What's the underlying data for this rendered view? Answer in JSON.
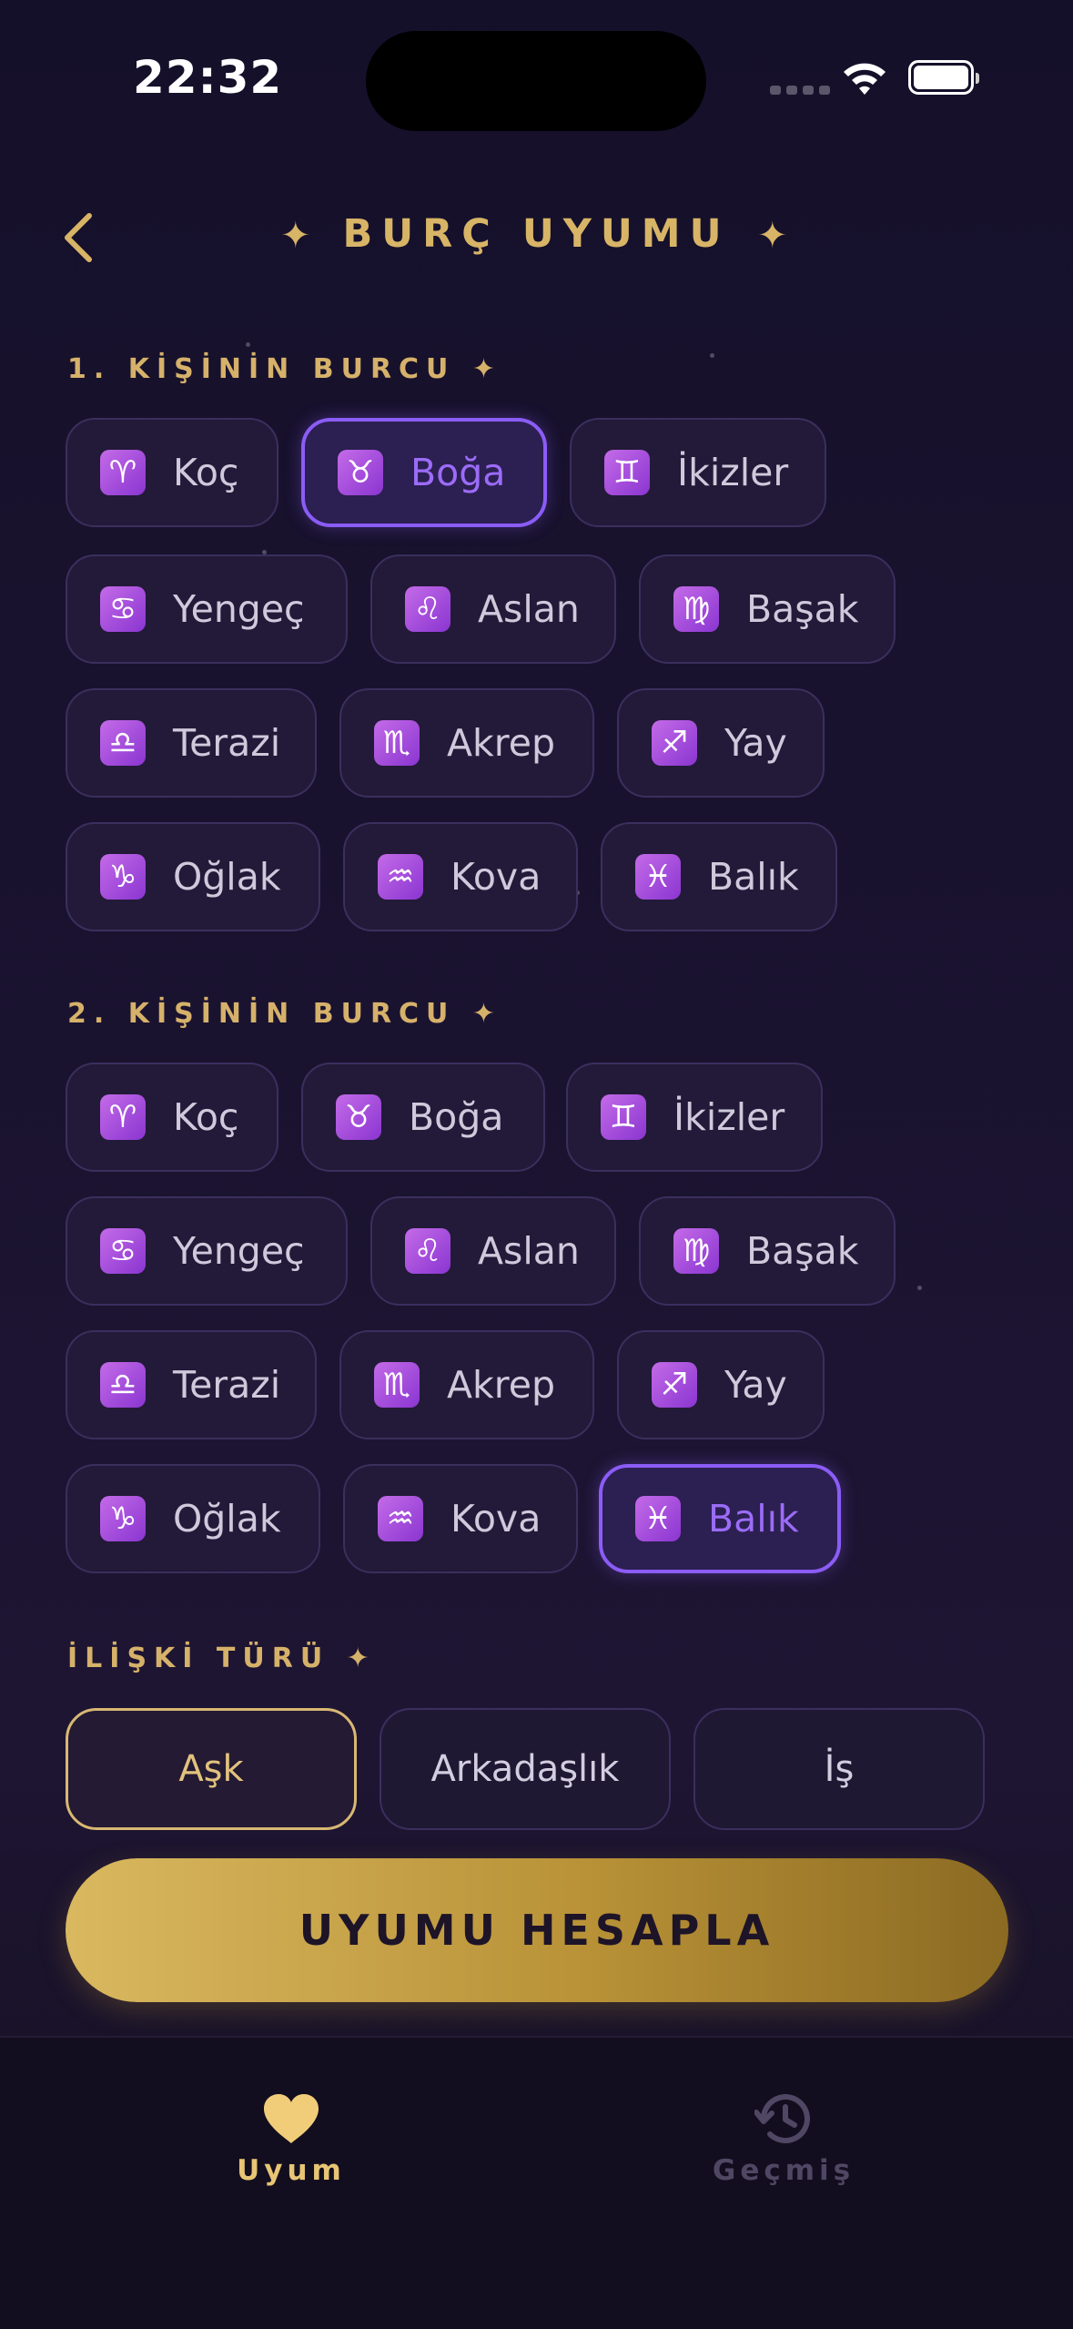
{
  "status_bar": {
    "time": "22:32"
  },
  "header": {
    "title": "BURÇ UYUMU",
    "star_glyph": "✦"
  },
  "person1": {
    "label": "1. KİŞİNİN BURCU ✦",
    "selected": "Boğa",
    "signs": [
      {
        "name": "Koç",
        "icon": "aries-icon",
        "glyph": "♈"
      },
      {
        "name": "Boğa",
        "icon": "taurus-icon",
        "glyph": "♉"
      },
      {
        "name": "İkizler",
        "icon": "gemini-icon",
        "glyph": "♊"
      },
      {
        "name": "Yengeç",
        "icon": "cancer-icon",
        "glyph": "♋"
      },
      {
        "name": "Aslan",
        "icon": "leo-icon",
        "glyph": "♌"
      },
      {
        "name": "Başak",
        "icon": "virgo-icon",
        "glyph": "♍"
      },
      {
        "name": "Terazi",
        "icon": "libra-icon",
        "glyph": "♎"
      },
      {
        "name": "Akrep",
        "icon": "scorpio-icon",
        "glyph": "♏"
      },
      {
        "name": "Yay",
        "icon": "sagittarius-icon",
        "glyph": "♐"
      },
      {
        "name": "Oğlak",
        "icon": "capricorn-icon",
        "glyph": "♑"
      },
      {
        "name": "Kova",
        "icon": "aquarius-icon",
        "glyph": "♒"
      },
      {
        "name": "Balık",
        "icon": "pisces-icon",
        "glyph": "♓"
      }
    ]
  },
  "person2": {
    "label": "2. KİŞİNİN BURCU ✦",
    "selected": "Balık",
    "signs": [
      {
        "name": "Koç",
        "icon": "aries-icon",
        "glyph": "♈"
      },
      {
        "name": "Boğa",
        "icon": "taurus-icon",
        "glyph": "♉"
      },
      {
        "name": "İkizler",
        "icon": "gemini-icon",
        "glyph": "♊"
      },
      {
        "name": "Yengeç",
        "icon": "cancer-icon",
        "glyph": "♋"
      },
      {
        "name": "Aslan",
        "icon": "leo-icon",
        "glyph": "♌"
      },
      {
        "name": "Başak",
        "icon": "virgo-icon",
        "glyph": "♍"
      },
      {
        "name": "Terazi",
        "icon": "libra-icon",
        "glyph": "♎"
      },
      {
        "name": "Akrep",
        "icon": "scorpio-icon",
        "glyph": "♏"
      },
      {
        "name": "Yay",
        "icon": "sagittarius-icon",
        "glyph": "♐"
      },
      {
        "name": "Oğlak",
        "icon": "capricorn-icon",
        "glyph": "♑"
      },
      {
        "name": "Kova",
        "icon": "aquarius-icon",
        "glyph": "♒"
      },
      {
        "name": "Balık",
        "icon": "pisces-icon",
        "glyph": "♓"
      }
    ]
  },
  "relationship": {
    "label": "İLİŞKİ TÜRÜ ✦",
    "selected": "Aşk",
    "options": [
      "Aşk",
      "Arkadaşlık",
      "İş"
    ]
  },
  "cta": {
    "label": "UYUMU HESAPLA"
  },
  "tab_bar": {
    "tabs": [
      {
        "label": "Uyum",
        "icon": "heart-icon",
        "active": true
      },
      {
        "label": "Geçmiş",
        "icon": "history-icon",
        "active": false
      }
    ]
  },
  "colors": {
    "gold": "#d8b467",
    "purple_accent": "#8b5cf6",
    "inactive_tab": "#4f4763"
  }
}
